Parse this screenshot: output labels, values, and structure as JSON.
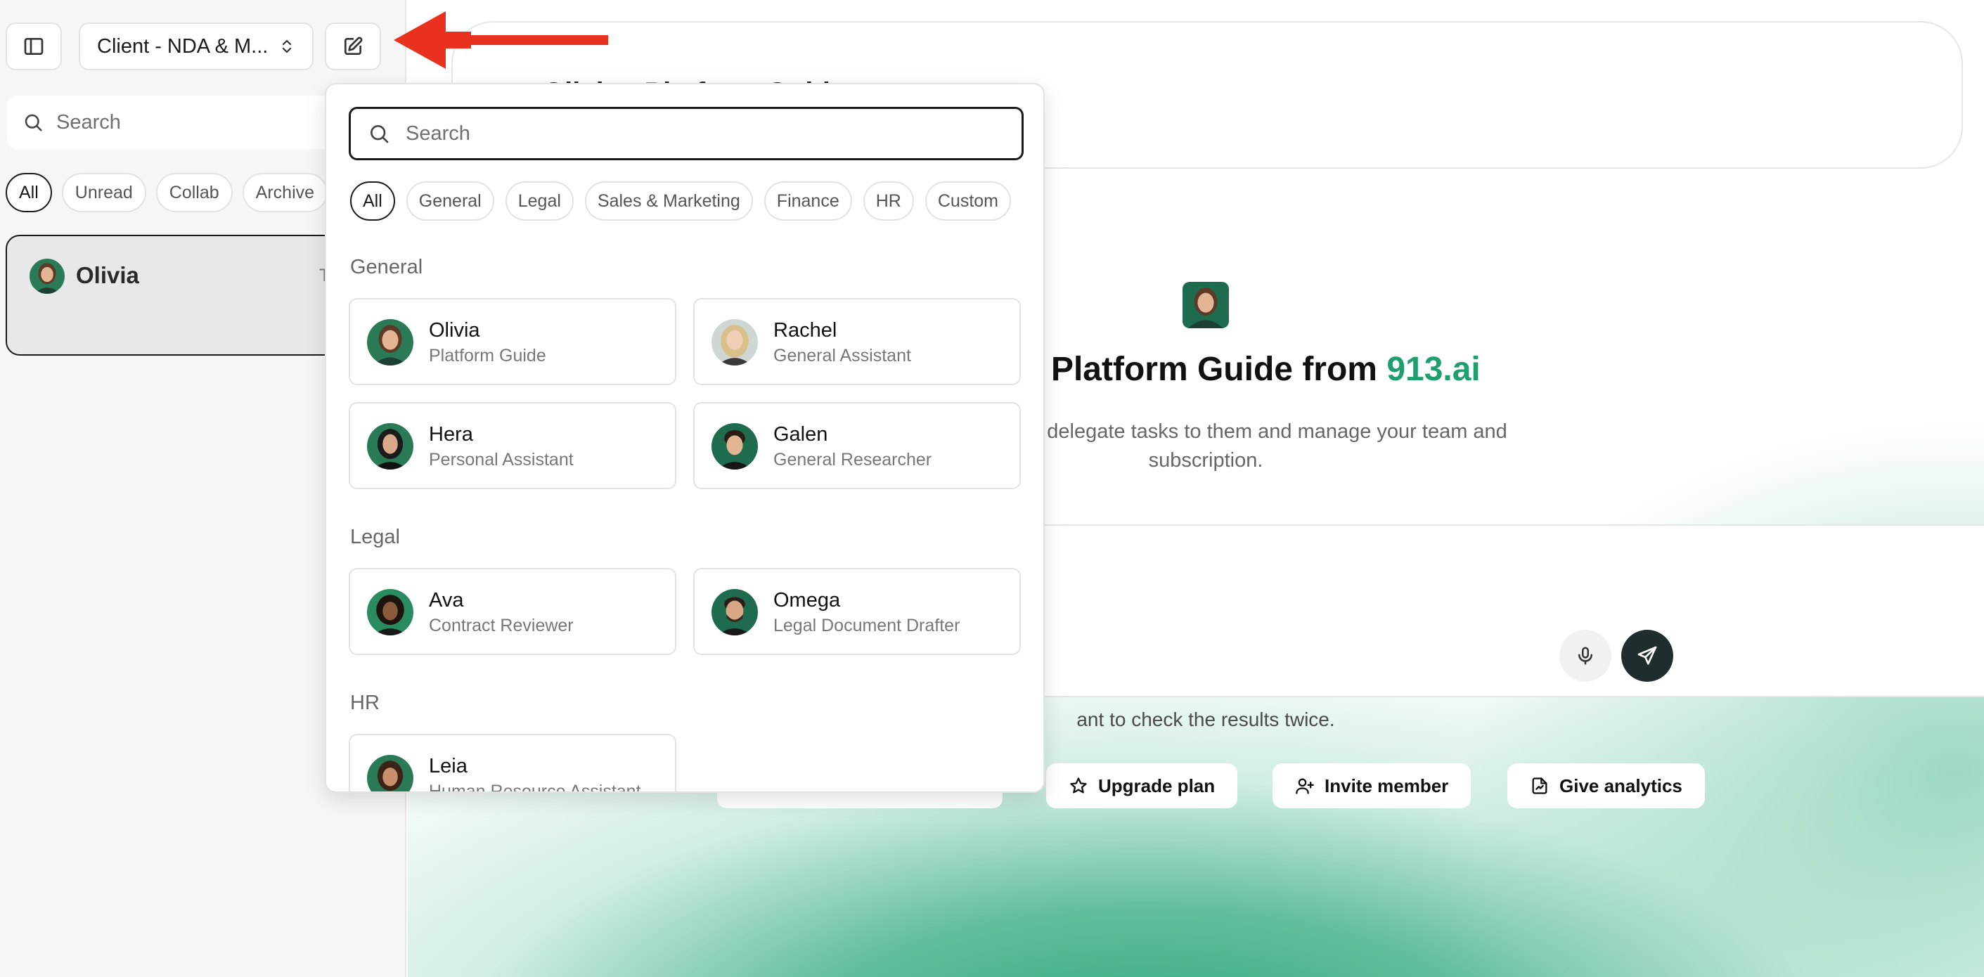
{
  "sidebar": {
    "workspace_label": "Client - NDA & M...",
    "search_placeholder": "Search",
    "filters": [
      "All",
      "Unread",
      "Collab",
      "Archive"
    ],
    "conversation": {
      "name": "Olivia",
      "time": "To"
    }
  },
  "header": {
    "title": "Olivia - Platform Guide"
  },
  "hero": {
    "title_prefix": "a, your Platform Guide from ",
    "brand": "913.ai",
    "subtitle_line1": "ents, I can also delegate tasks to them and manage your team and",
    "subtitle_line2": "subscription."
  },
  "disclaimer": "ant to check the results twice.",
  "actions": {
    "upgrade": "Upgrade plan",
    "invite": "Invite member",
    "analytics": "Give analytics"
  },
  "dropdown": {
    "search_placeholder": "Search",
    "filters": [
      "All",
      "General",
      "Legal",
      "Sales & Marketing",
      "Finance",
      "HR",
      "Custom"
    ],
    "sections": {
      "general": "General",
      "legal": "Legal",
      "hr": "HR"
    },
    "agents": {
      "olivia": {
        "name": "Olivia",
        "role": "Platform Guide"
      },
      "rachel": {
        "name": "Rachel",
        "role": "General Assistant"
      },
      "hera": {
        "name": "Hera",
        "role": "Personal Assistant"
      },
      "galen": {
        "name": "Galen",
        "role": "General Researcher"
      },
      "ava": {
        "name": "Ava",
        "role": "Contract Reviewer"
      },
      "omega": {
        "name": "Omega",
        "role": "Legal Document Drafter"
      },
      "leia": {
        "name": "Leia",
        "role": "Human Resource Assistant"
      }
    }
  },
  "colors": {
    "brand_green": "#1f9e6e",
    "arrow_red": "#e8321f",
    "send_button": "#1f2d2f"
  }
}
